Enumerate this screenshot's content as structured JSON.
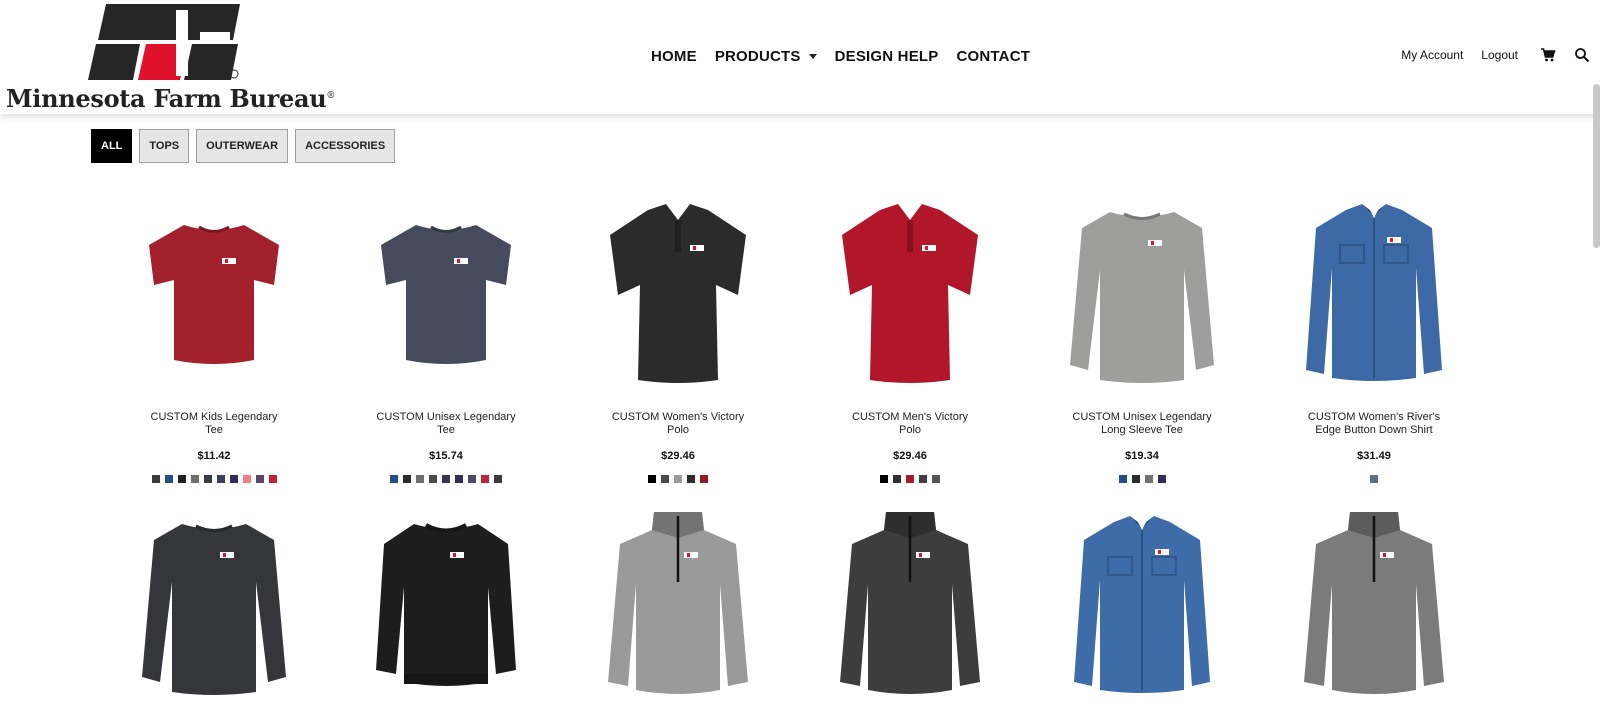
{
  "brand": {
    "name": "Minnesota Farm Bureau",
    "mark_primary": "#262626",
    "mark_accent": "#e0112b"
  },
  "nav": {
    "items": [
      {
        "label": "HOME"
      },
      {
        "label": "PRODUCTS",
        "has_dropdown": true
      },
      {
        "label": "DESIGN HELP"
      },
      {
        "label": "CONTACT"
      }
    ]
  },
  "utility": {
    "account_label": "My Account",
    "logout_label": "Logout",
    "cart_icon": "cart-icon",
    "search_icon": "search-icon"
  },
  "filters": [
    {
      "label": "ALL",
      "active": true
    },
    {
      "label": "TOPS",
      "active": false
    },
    {
      "label": "OUTERWEAR",
      "active": false
    },
    {
      "label": "ACCESSORIES",
      "active": false
    }
  ],
  "products": [
    {
      "name": "CUSTOM Kids Legendary Tee",
      "price": "$11.42",
      "garment": "tshirt",
      "color": "#a3202d",
      "swatches": [
        "#3a3a3a",
        "#1f4f86",
        "#222222",
        "#6e6e6e",
        "#363b45",
        "#3a3f5c",
        "#2c2d58",
        "#f07d8a",
        "#5a4660",
        "#c41e3a"
      ]
    },
    {
      "name": "CUSTOM Unisex Legendary Tee",
      "price": "$15.74",
      "garment": "tshirt",
      "color": "#454b5c",
      "swatches": [
        "#1f4f86",
        "#2b2b2b",
        "#6d6d6d",
        "#4c4c4c",
        "#34384e",
        "#2d2e5a",
        "#504860",
        "#c41e3a",
        "#3a3a3a"
      ]
    },
    {
      "name": "CUSTOM Women's Victory Polo",
      "price": "$29.46",
      "garment": "polo",
      "color": "#2b2b2b",
      "swatches": [
        "#000000",
        "#4a4a4a",
        "#9b9b9b",
        "#2b2b2b",
        "#9a1628"
      ]
    },
    {
      "name": "CUSTOM Men's Victory Polo",
      "price": "$29.46",
      "garment": "polo",
      "color": "#b1162a",
      "swatches": [
        "#000000",
        "#2f2f2f",
        "#a51a2e",
        "#3f3f3f",
        "#555555"
      ]
    },
    {
      "name": "CUSTOM Unisex Legendary Long Sleeve Tee",
      "price": "$19.34",
      "garment": "longsleeve",
      "color": "#9e9e9c",
      "swatches": [
        "#1f4f86",
        "#2b2b2b",
        "#707070",
        "#2f2f55"
      ]
    },
    {
      "name": "CUSTOM Women's River's Edge Button Down Shirt",
      "price": "$31.49",
      "garment": "buttondown",
      "color": "#3d6aa6",
      "swatches": [
        "#5d6f88"
      ]
    },
    {
      "name": "",
      "price": "",
      "garment": "longsleeve",
      "color": "#35363a",
      "swatches": []
    },
    {
      "name": "",
      "price": "",
      "garment": "sweatshirt",
      "color": "#1d1d1d",
      "swatches": []
    },
    {
      "name": "",
      "price": "",
      "garment": "quarterzip",
      "color": "#9a9a9a",
      "swatches": []
    },
    {
      "name": "",
      "price": "",
      "garment": "quarterzip",
      "color": "#3d3d3d",
      "swatches": []
    },
    {
      "name": "",
      "price": "",
      "garment": "buttondown",
      "color": "#3e6ca8",
      "swatches": []
    },
    {
      "name": "",
      "price": "",
      "garment": "quarterzip",
      "color": "#7b7b7b",
      "swatches": []
    }
  ]
}
